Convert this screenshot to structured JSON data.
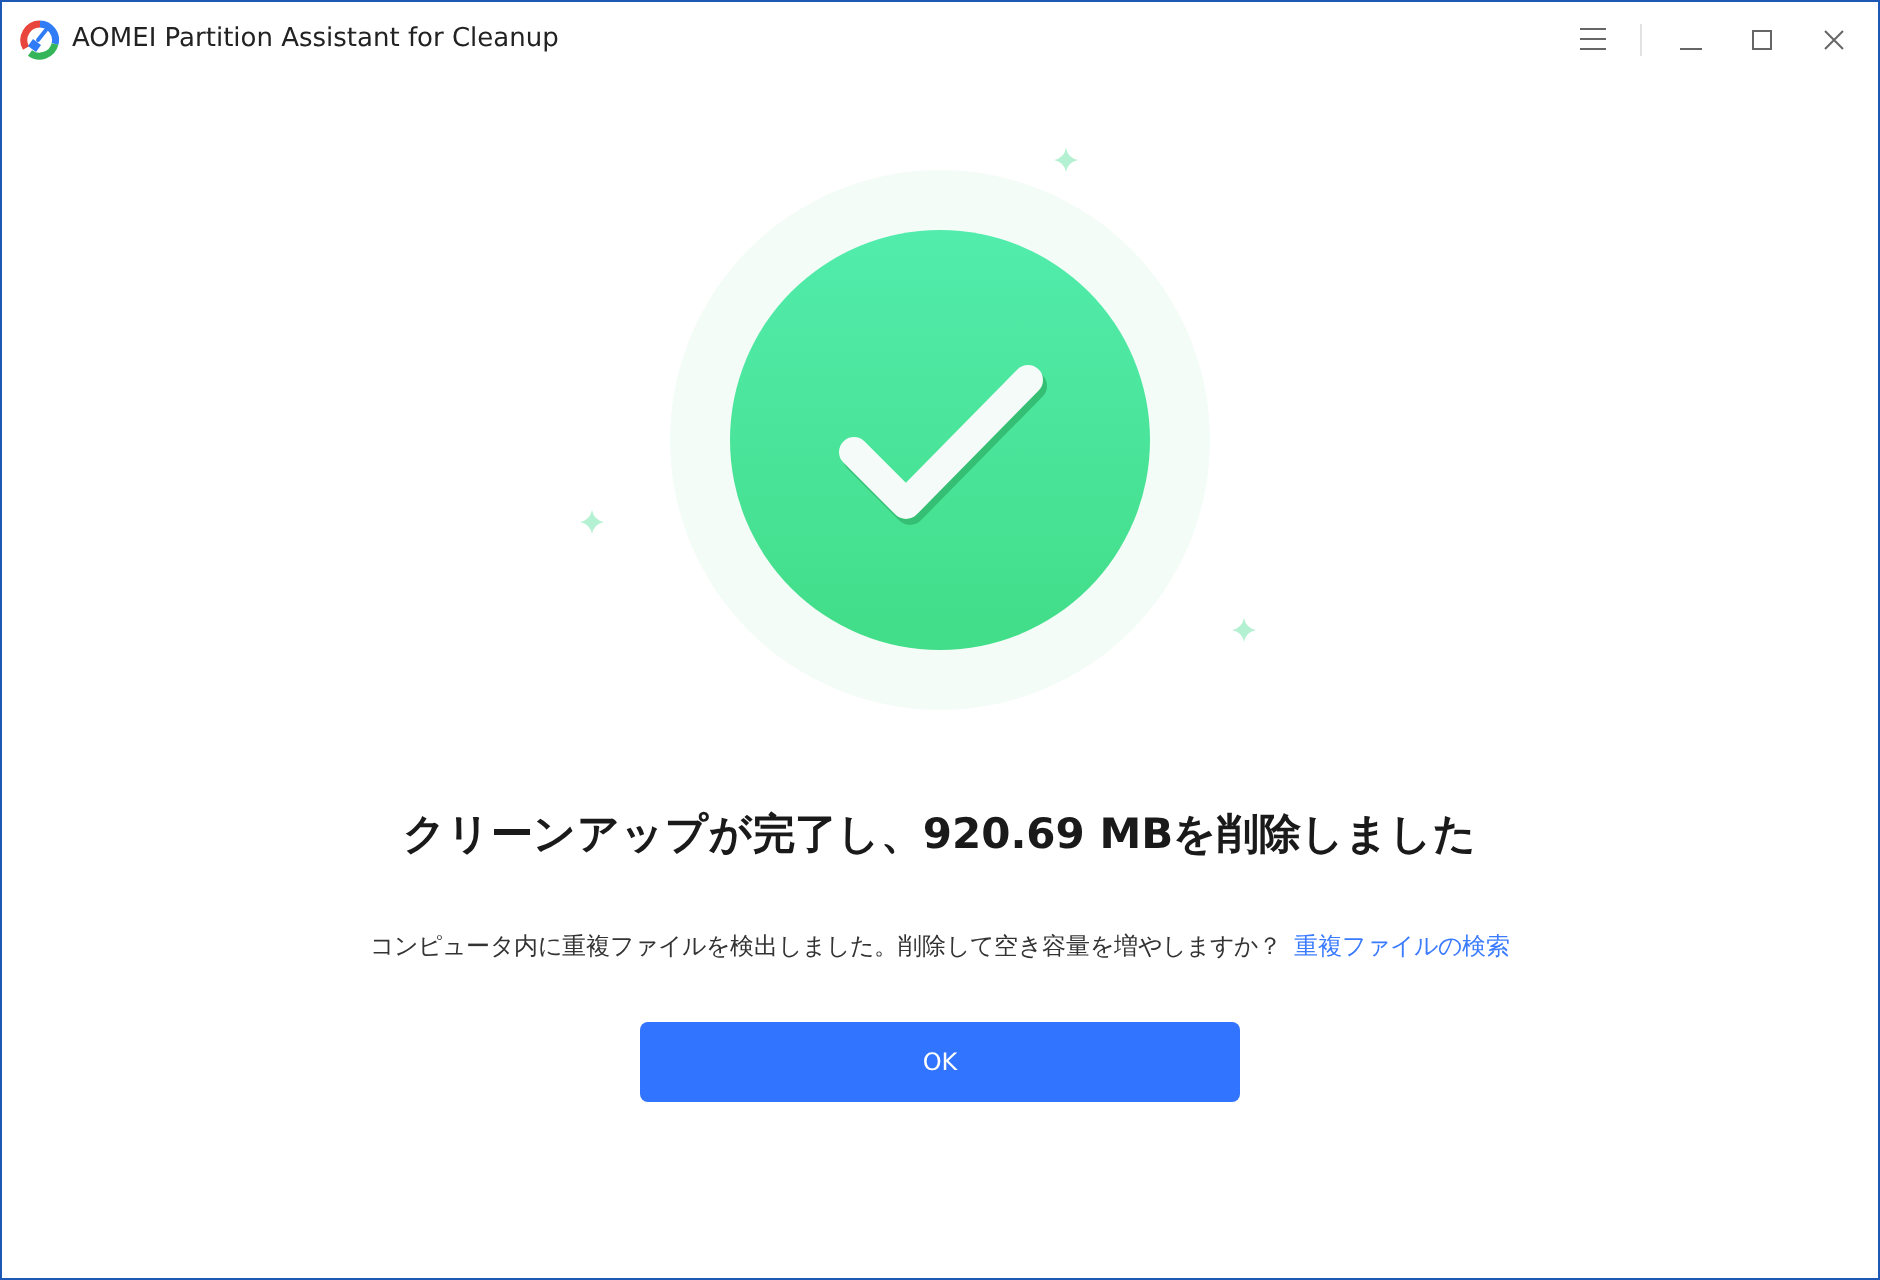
{
  "window": {
    "title": "AOMEI Partition Assistant for Cleanup"
  },
  "result": {
    "heading": "クリーンアップが完了し、920.69 MBを削除しました",
    "message": "コンピュータ内に重複ファイルを検出しました。削除して空き容量を増やしますか？",
    "link": "重複ファイルの検索"
  },
  "button": {
    "label": "OK"
  }
}
